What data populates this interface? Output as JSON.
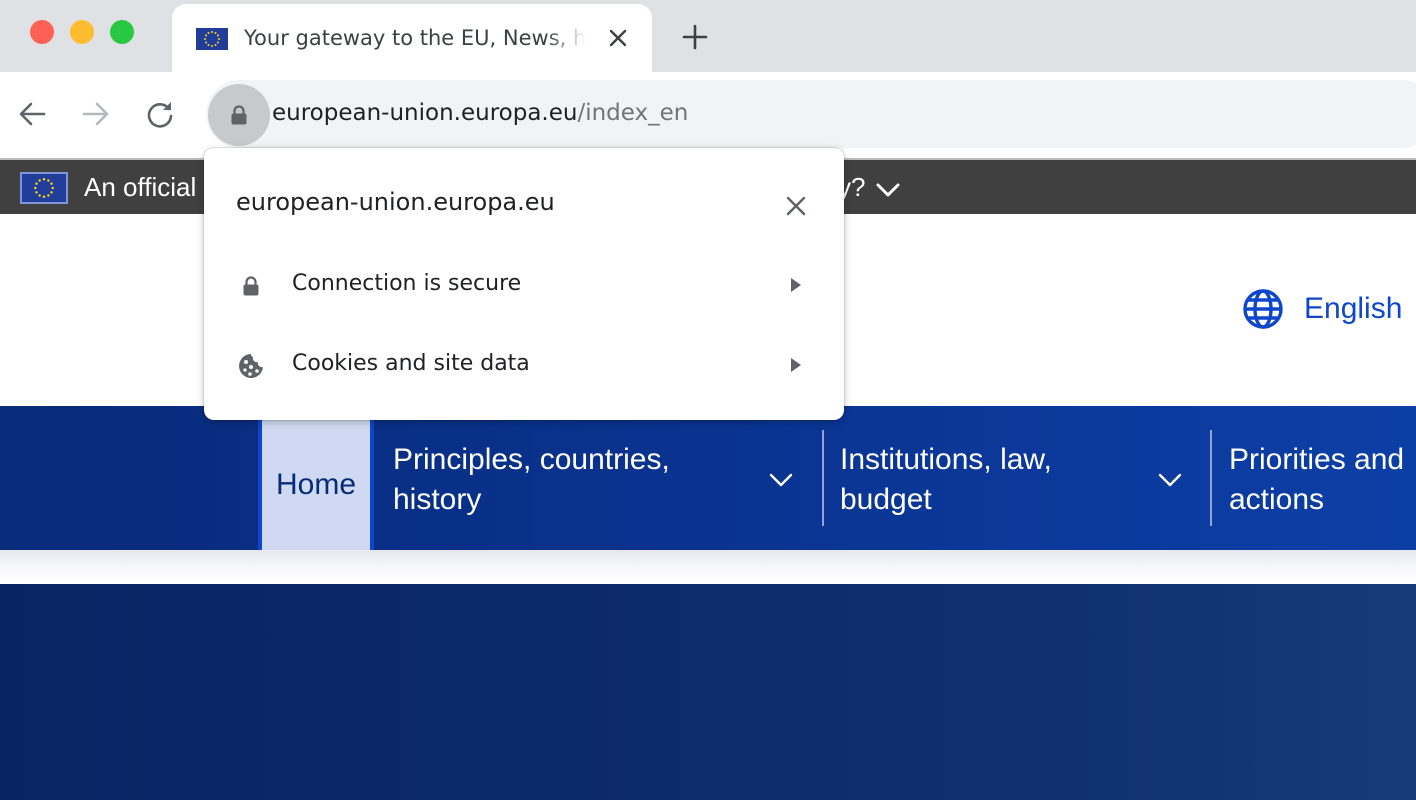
{
  "browser": {
    "tab": {
      "title": "Your gateway to the EU, News, highlights",
      "favicon": "eu-flag-icon",
      "close_icon": "close-icon"
    },
    "new_tab_icon": "plus-icon",
    "toolbar": {
      "back_icon": "arrow-left-icon",
      "forward_icon": "arrow-right-icon",
      "reload_icon": "reload-icon",
      "site_info_icon": "lock-icon"
    },
    "omnibox": {
      "domain": "european-union.europa.eu",
      "path": "/index_en"
    }
  },
  "site_info_popup": {
    "title": "european-union.europa.eu",
    "close_icon": "close-icon",
    "rows": [
      {
        "icon": "lock-icon",
        "label": "Connection is secure"
      },
      {
        "icon": "cookie-icon",
        "label": "Cookies and site data"
      }
    ]
  },
  "page": {
    "gov_banner": {
      "text_visible_start": "An official",
      "text_visible_end": "y?",
      "toggle_icon": "chevron-down-icon"
    },
    "language": {
      "icon": "globe-icon",
      "label": "English"
    },
    "main_nav": [
      {
        "label": "Home",
        "active": true
      },
      {
        "label": "Principles, countries,\nhistory",
        "has_dropdown": true
      },
      {
        "label": "Institutions, law,\nbudget",
        "has_dropdown": true
      },
      {
        "label": "Priorities and\nactions",
        "has_dropdown": false
      }
    ],
    "colors": {
      "brand_blue": "#0e47cb",
      "nav_bg": "#0a3390",
      "home_active_bg": "#cfdaf2",
      "gov_banner_bg": "#404040",
      "hero_bg": "#0b2a6c"
    }
  }
}
